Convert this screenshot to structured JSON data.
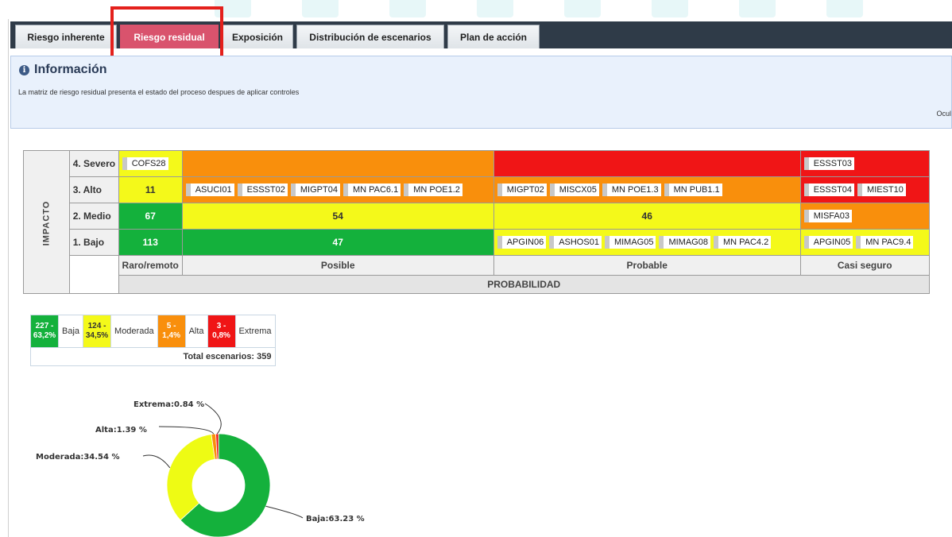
{
  "tabs": [
    {
      "label": "Riesgo inherente",
      "active": false
    },
    {
      "label": "Riesgo residual",
      "active": true
    },
    {
      "label": "Exposición",
      "active": false
    },
    {
      "label": "Distribución de escenarios",
      "active": false
    },
    {
      "label": "Plan de acción",
      "active": false
    }
  ],
  "info": {
    "title": "Información",
    "text": "La matriz de riesgo residual presenta el estado del proceso despues de aplicar controles",
    "hide_label": "Ocul"
  },
  "matrix": {
    "axis_label": "IMPACTO",
    "rows": {
      "severo": {
        "label": "4. Severo",
        "c1": [
          "COFS28"
        ],
        "c4": [
          "ESSST03"
        ]
      },
      "alto": {
        "label": "3. Alto",
        "c1": "11",
        "c2": [
          "ASUCI01",
          "ESSST02",
          "MIGPT04",
          "MN PAC6.1",
          "MN POE1.2"
        ],
        "c3": [
          "MIGPT02",
          "MISCX05",
          "MN POE1.3",
          "MN PUB1.1"
        ],
        "c4": [
          "ESSST04",
          "MIEST10"
        ]
      },
      "medio": {
        "label": "2. Medio",
        "c1": "67",
        "c2": "54",
        "c3": "46",
        "c4": [
          "MISFA03"
        ]
      },
      "bajo": {
        "label": "1. Bajo",
        "c1": "113",
        "c2": "47",
        "c3": [
          "APGIN06",
          "ASHOS01",
          "MIMAG05",
          "MIMAG08",
          "MN PAC4.2"
        ],
        "c4": [
          "APGIN05",
          "MN PAC9.4"
        ]
      }
    },
    "columns": [
      "Raro/remoto",
      "Posible",
      "Probable",
      "Casi seguro"
    ],
    "prob_label": "PROBABILIDAD"
  },
  "legend": {
    "items": [
      {
        "count": "227 -",
        "pct": "63,2%",
        "label": "Baja",
        "color": "#14b13c"
      },
      {
        "count": "124 -",
        "pct": "34,5%",
        "label": "Moderada",
        "color": "#f4f91a"
      },
      {
        "count": "5 -",
        "pct": "1,4%",
        "label": "Alta",
        "color": "#f98f0c"
      },
      {
        "count": "3 -",
        "pct": "0,8%",
        "label": "Extrema",
        "color": "#f01516"
      }
    ],
    "total": "Total escenarios: 359"
  },
  "chart_data": {
    "type": "pie",
    "donut": true,
    "labels": [
      "Baja",
      "Moderada",
      "Alta",
      "Extrema"
    ],
    "values": [
      63.23,
      34.54,
      1.39,
      0.84
    ],
    "colors": [
      "#14b13c",
      "#eefb14",
      "#f98f0c",
      "#f01516"
    ],
    "data_labels": [
      "Baja:63.23 %",
      "Moderada:34.54 %",
      "Alta:1.39 %",
      "Extrema:0.84 %"
    ]
  },
  "colors": {
    "tabbar": "#2f3b48",
    "active_tab": "#d9536d",
    "highlight_box": "#e4201c",
    "info_bg": "#e9f1fc"
  }
}
